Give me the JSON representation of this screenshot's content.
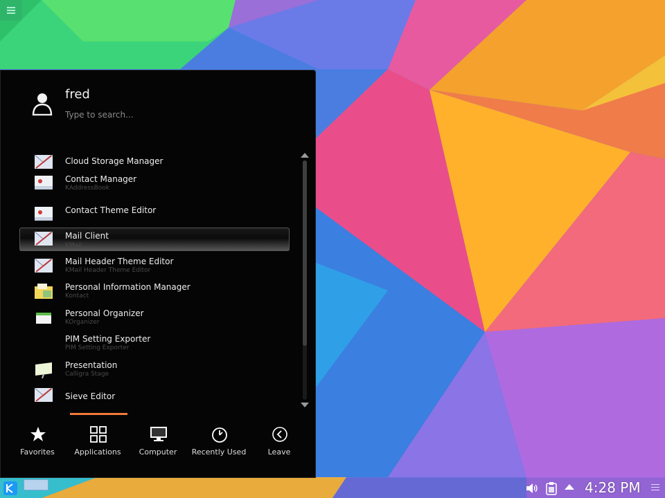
{
  "user": {
    "name": "fred"
  },
  "search": {
    "placeholder": "Type to search..."
  },
  "apps": [
    {
      "name": "Cloud Storage Manager",
      "subtitle": "",
      "icon": "mail-app-icon"
    },
    {
      "name": "Contact Manager",
      "subtitle": "KAddressBook",
      "icon": "contact-app-icon"
    },
    {
      "name": "Contact Theme Editor",
      "subtitle": "",
      "icon": "contact-app-icon"
    },
    {
      "name": "Mail Client",
      "subtitle": "KMail",
      "icon": "mail-app-icon"
    },
    {
      "name": "Mail Header Theme Editor",
      "subtitle": "KMail Header Theme Editor",
      "icon": "mail-app-icon"
    },
    {
      "name": "Personal Information Manager",
      "subtitle": "Kontact",
      "icon": "kontact-app-icon"
    },
    {
      "name": "Personal Organizer",
      "subtitle": "KOrganizer",
      "icon": "calendar-app-icon"
    },
    {
      "name": "PIM Setting Exporter",
      "subtitle": "PIM Setting Exporter",
      "icon": ""
    },
    {
      "name": "Presentation",
      "subtitle": "Calligra Stage",
      "icon": "presentation-app-icon"
    },
    {
      "name": "Sieve Editor",
      "subtitle": "",
      "icon": "mail-app-icon"
    }
  ],
  "selected_app": "Mail Client",
  "tabs": [
    {
      "label": "Favorites",
      "icon": "star-icon"
    },
    {
      "label": "Applications",
      "icon": "grid-icon"
    },
    {
      "label": "Computer",
      "icon": "monitor-icon"
    },
    {
      "label": "Recently Used",
      "icon": "clock-icon"
    },
    {
      "label": "Leave",
      "icon": "back-circle-icon"
    }
  ],
  "active_tab": "Applications",
  "taskbar": {
    "clock": "4:28 PM"
  },
  "colors": {
    "accent": "#f37a3a",
    "panel_bg": "#050505"
  }
}
